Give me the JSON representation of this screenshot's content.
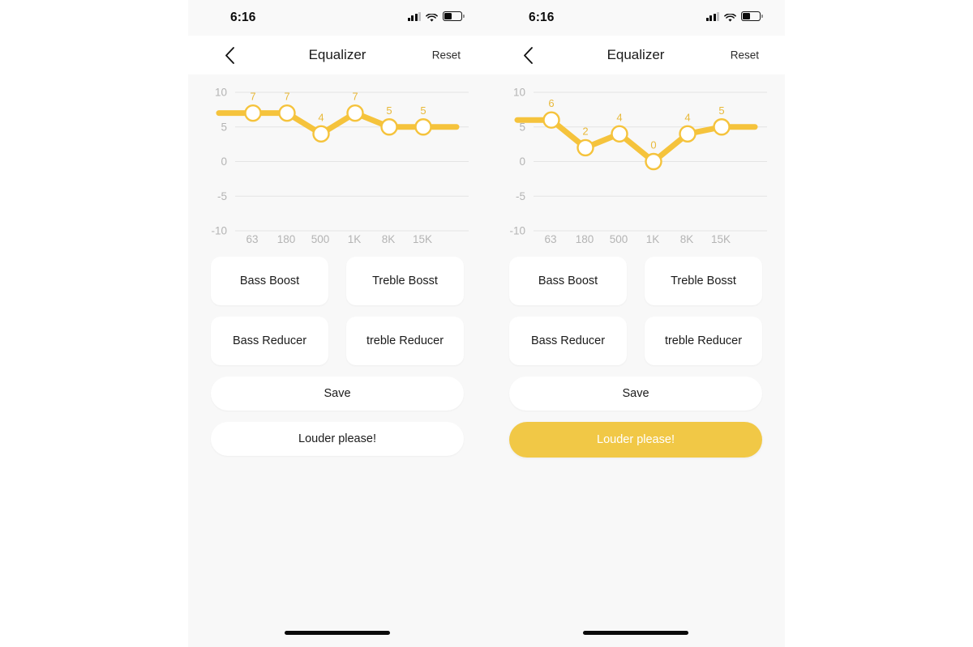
{
  "screen": {
    "page_background": "#ffffff",
    "panel_background": "#f8f8f8",
    "accent_color": "#f1c846",
    "line_color": "#f5c33c",
    "label_color": "#e8b93a"
  },
  "panels": [
    {
      "id": "panel-left",
      "status_bar": {
        "time": "6:16",
        "signal_icon": "cellular-bars-icon",
        "wifi_icon": "wifi-icon",
        "battery_icon": "battery-icon"
      },
      "nav": {
        "back_icon": "chevron-left-icon",
        "title": "Equalizer",
        "reset_label": "Reset"
      },
      "chart_data": {
        "type": "line",
        "title": "Equalizer",
        "categories": [
          "63",
          "180",
          "500",
          "1K",
          "8K",
          "15K"
        ],
        "values": [
          7,
          7,
          4,
          7,
          5,
          5
        ],
        "point_labels": [
          "7",
          "7",
          "4",
          "7",
          "5",
          "5"
        ],
        "ylabel": "",
        "xlabel": "",
        "ylim": [
          -10,
          10
        ],
        "yticks": [
          10,
          5,
          0,
          -5,
          -10
        ],
        "ytick_labels": [
          "10",
          "5",
          "0",
          "-5",
          "-10"
        ],
        "grid": true,
        "legend": "none"
      },
      "presets": [
        {
          "label": "Bass Boost",
          "name": "bass-boost"
        },
        {
          "label": "Treble Bosst",
          "name": "treble-boost"
        },
        {
          "label": "Bass Reducer",
          "name": "bass-reducer"
        },
        {
          "label": "treble Reducer",
          "name": "treble-reducer"
        }
      ],
      "save_label": "Save",
      "louder_label": "Louder please!",
      "louder_active": false
    },
    {
      "id": "panel-right",
      "status_bar": {
        "time": "6:16",
        "signal_icon": "cellular-bars-icon",
        "wifi_icon": "wifi-icon",
        "battery_icon": "battery-icon"
      },
      "nav": {
        "back_icon": "chevron-left-icon",
        "title": "Equalizer",
        "reset_label": "Reset"
      },
      "chart_data": {
        "type": "line",
        "title": "Equalizer",
        "categories": [
          "63",
          "180",
          "500",
          "1K",
          "8K",
          "15K"
        ],
        "values": [
          6,
          2,
          4,
          0,
          4,
          5
        ],
        "point_labels": [
          "6",
          "2",
          "4",
          "0",
          "4",
          "5"
        ],
        "ylabel": "",
        "xlabel": "",
        "ylim": [
          -10,
          10
        ],
        "yticks": [
          10,
          5,
          0,
          -5,
          -10
        ],
        "ytick_labels": [
          "10",
          "5",
          "0",
          "-5",
          "-10"
        ],
        "grid": true,
        "legend": "none"
      },
      "presets": [
        {
          "label": "Bass Boost",
          "name": "bass-boost"
        },
        {
          "label": "Treble Bosst",
          "name": "treble-boost"
        },
        {
          "label": "Bass Reducer",
          "name": "bass-reducer"
        },
        {
          "label": "treble Reducer",
          "name": "treble-reducer"
        }
      ],
      "save_label": "Save",
      "louder_label": "Louder please!",
      "louder_active": true
    }
  ]
}
